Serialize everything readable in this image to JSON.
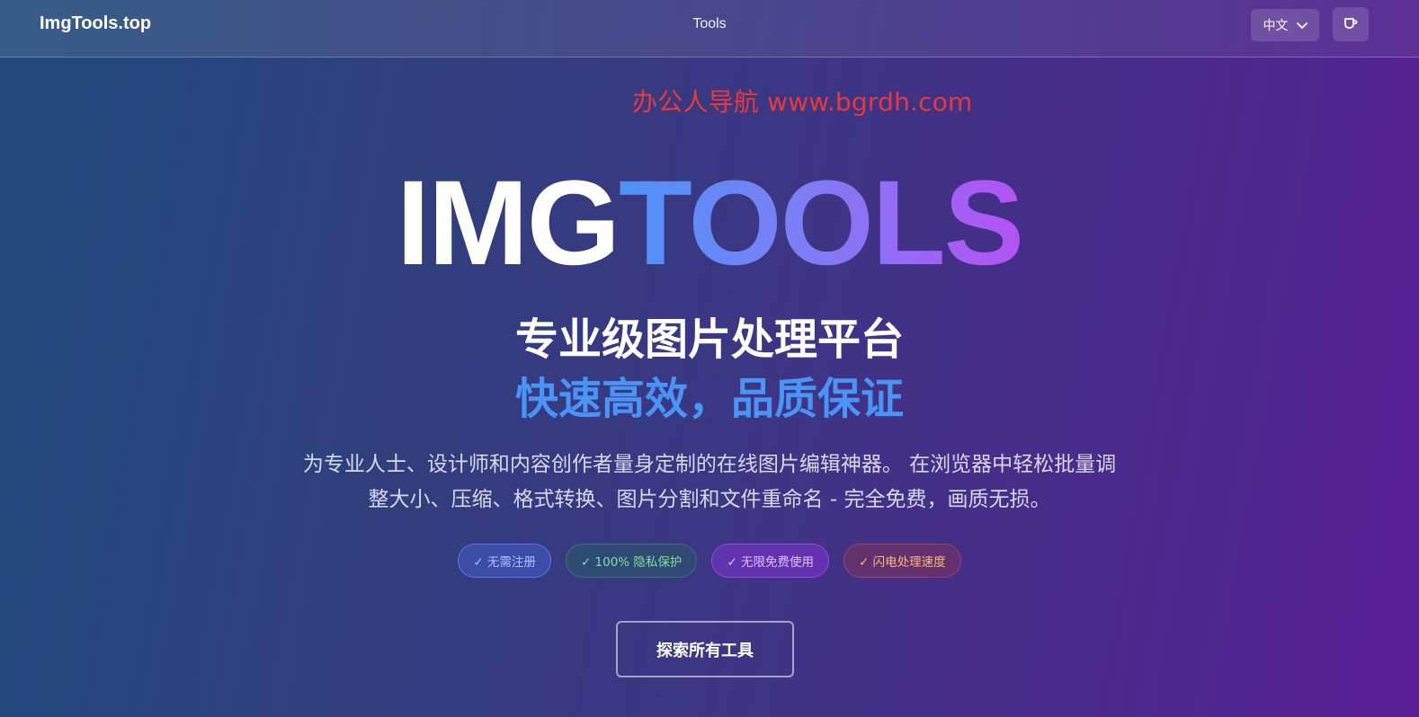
{
  "header": {
    "logo": "ImgTools.top",
    "nav_tools": "Tools",
    "language": "中文",
    "coffee_icon": "coffee-cup-icon",
    "chevron_icon": "chevron-down-icon"
  },
  "watermark": "办公人导航 www.bgrdh.com",
  "hero": {
    "title_white": "IMG",
    "title_gradient": "TOOLS",
    "subtitle": "专业级图片处理平台",
    "tagline": "快速高效，品质保证",
    "description": "为专业人士、设计师和内容创作者量身定制的在线图片编辑神器。 在浏览器中轻松批量调整大小、压缩、格式转换、图片分割和文件重命名 - 完全免费，画质无损。"
  },
  "badges": [
    {
      "label": "✓ 无需注册"
    },
    {
      "label": "✓ 100% 隐私保护"
    },
    {
      "label": "✓ 无限免费使用"
    },
    {
      "label": "✓ 闪电处理速度"
    }
  ],
  "cta": {
    "explore_label": "探索所有工具"
  },
  "colors": {
    "accent_blue": "#4a94f5",
    "accent_purple": "#b452f2",
    "watermark_red": "#e8393f"
  }
}
